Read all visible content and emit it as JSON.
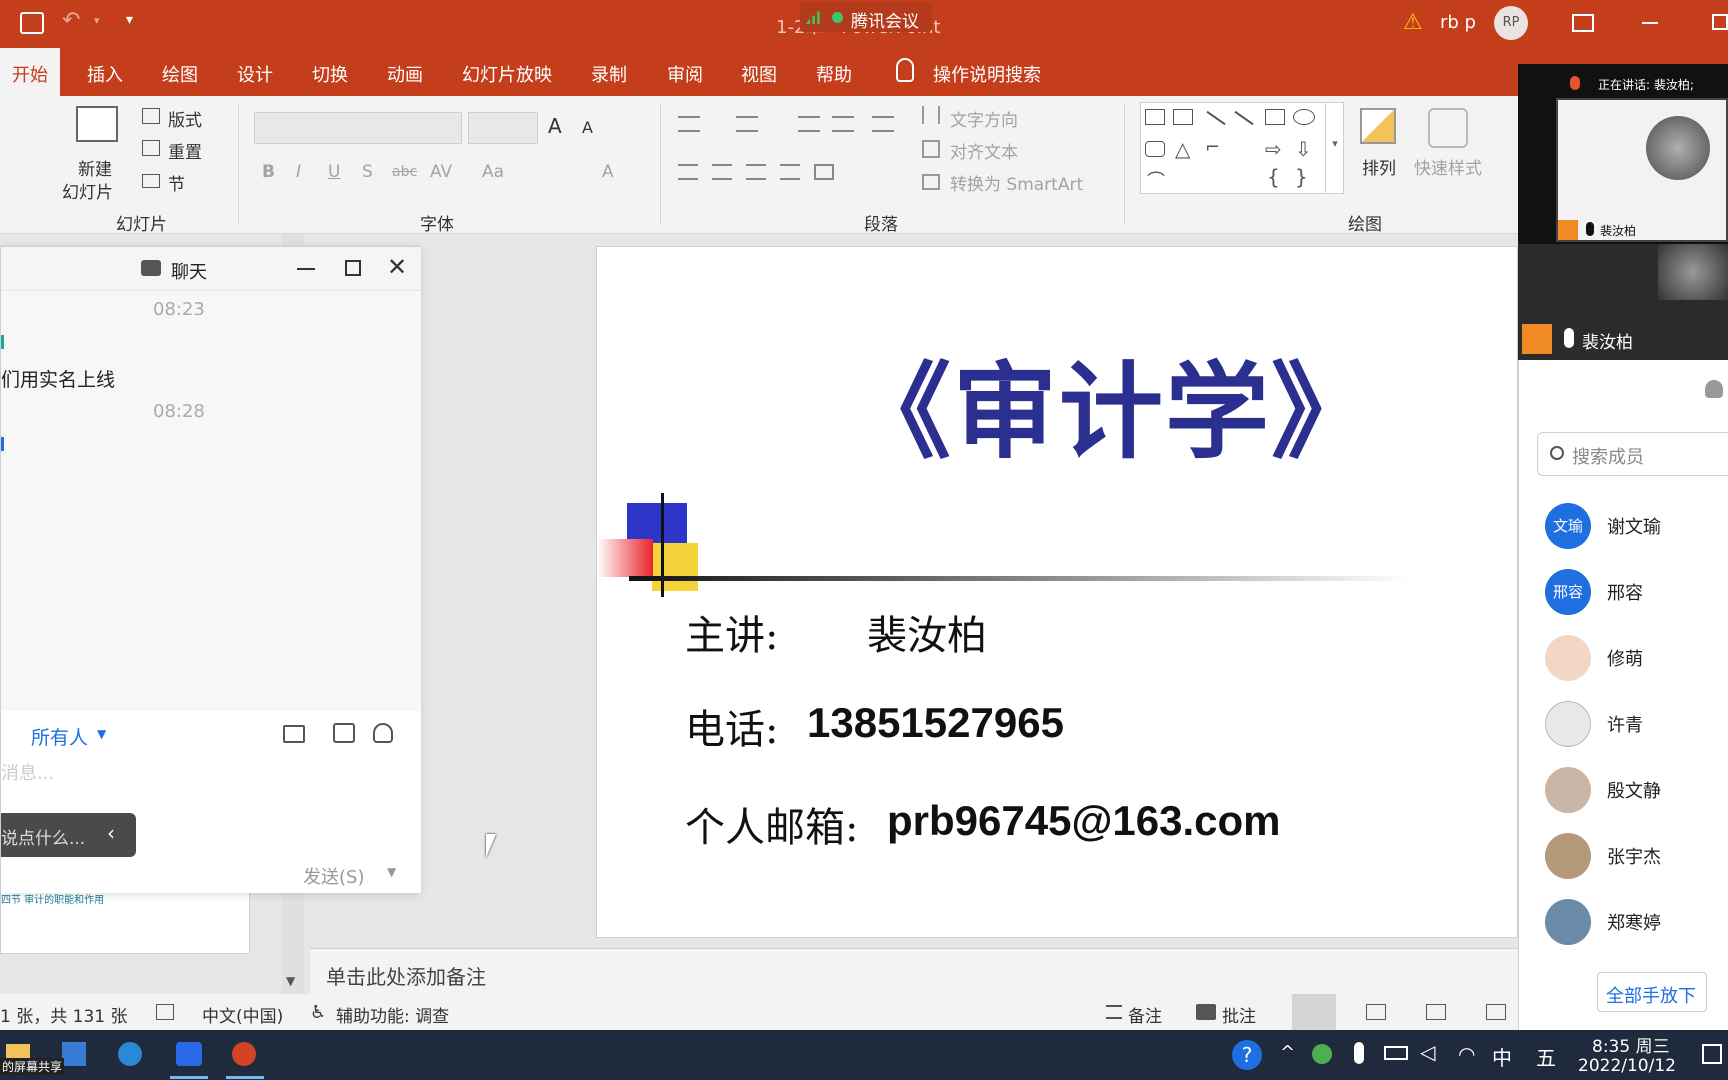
{
  "titlebar": {
    "doc_title": "1-2章 - PowerPoint",
    "meeting_label": "腾讯会议",
    "user_name": "rb p",
    "user_initials": "RP"
  },
  "ribbon_tabs": [
    "开始",
    "插入",
    "绘图",
    "设计",
    "切换",
    "动画",
    "幻灯片放映",
    "录制",
    "审阅",
    "视图",
    "帮助",
    "操作说明搜索"
  ],
  "ribbon": {
    "slides_group": {
      "new_slide": "新建",
      "new_slide2": "幻灯片",
      "layout": "版式",
      "reset": "重置",
      "section": "节",
      "label": "幻灯片"
    },
    "font_group": {
      "label": "字体",
      "bold": "B",
      "italic": "I",
      "underline": "U",
      "shadow": "S",
      "strike": "abc",
      "spacing": "AV",
      "case": "Aa",
      "grow": "A",
      "shrink": "A"
    },
    "paragraph_group": {
      "text_direction": "文字方向",
      "align_text": "对齐文本",
      "smartart": "转换为 SmartArt",
      "label": "段落"
    },
    "drawing_group": {
      "arrange": "排列",
      "quick_styles": "快速样式",
      "label": "绘图"
    }
  },
  "chat": {
    "title": "聊天",
    "messages": [
      {
        "time": "08:23"
      },
      {
        "text": "们用实名上线"
      },
      {
        "time": "08:28"
      }
    ],
    "recipient_label": "所有人",
    "input_placeholder": "消息...",
    "say_something": "说点什么...",
    "send_label": "发送(S)"
  },
  "slide": {
    "title": "《审计学》",
    "lecturer_label": "主讲:",
    "lecturer_name": "裴汝柏",
    "phone_label": "电话:",
    "phone": "13851527965",
    "email_label": "个人邮箱:",
    "email": "prb96745@163.com",
    "title_color": "#2b2f8f"
  },
  "thumb_caption": "四节  审计的职能和作用",
  "notes_placeholder": "单击此处添加备注",
  "statusbar": {
    "slide_count": "1 张，共 131 张",
    "language": "中文(中国)",
    "accessibility": "辅助功能: 调查",
    "notes": "备注",
    "comments": "批注"
  },
  "video": {
    "speaking_label": "正在讲话: 裴汝柏;",
    "tile_name_small": "裴汝柏",
    "tile_name": "裴汝柏"
  },
  "members": {
    "search_placeholder": "搜索成员",
    "list": [
      {
        "name": "谢文瑜",
        "avatar_text": "文瑜",
        "color": "#1f6fe0"
      },
      {
        "name": "邢容",
        "avatar_text": "邢容",
        "color": "#1f6fe0"
      },
      {
        "name": "修萌",
        "avatar_text": "",
        "color": "#f2d7c4"
      },
      {
        "name": "许青",
        "avatar_text": "",
        "color": "#e8e8e8"
      },
      {
        "name": "殷文静",
        "avatar_text": "",
        "color": "#c9b6a6"
      },
      {
        "name": "张宇杰",
        "avatar_text": "",
        "color": "#b49a7a"
      },
      {
        "name": "郑寒婷",
        "avatar_text": "",
        "color": "#6b8aa8"
      }
    ],
    "lower_all_hands": "全部手放下"
  },
  "taskbar": {
    "share_label": "的屏幕共享",
    "ime_lang": "中",
    "ime_mode": "五",
    "time": "8:35 周三",
    "date": "2022/10/12"
  }
}
